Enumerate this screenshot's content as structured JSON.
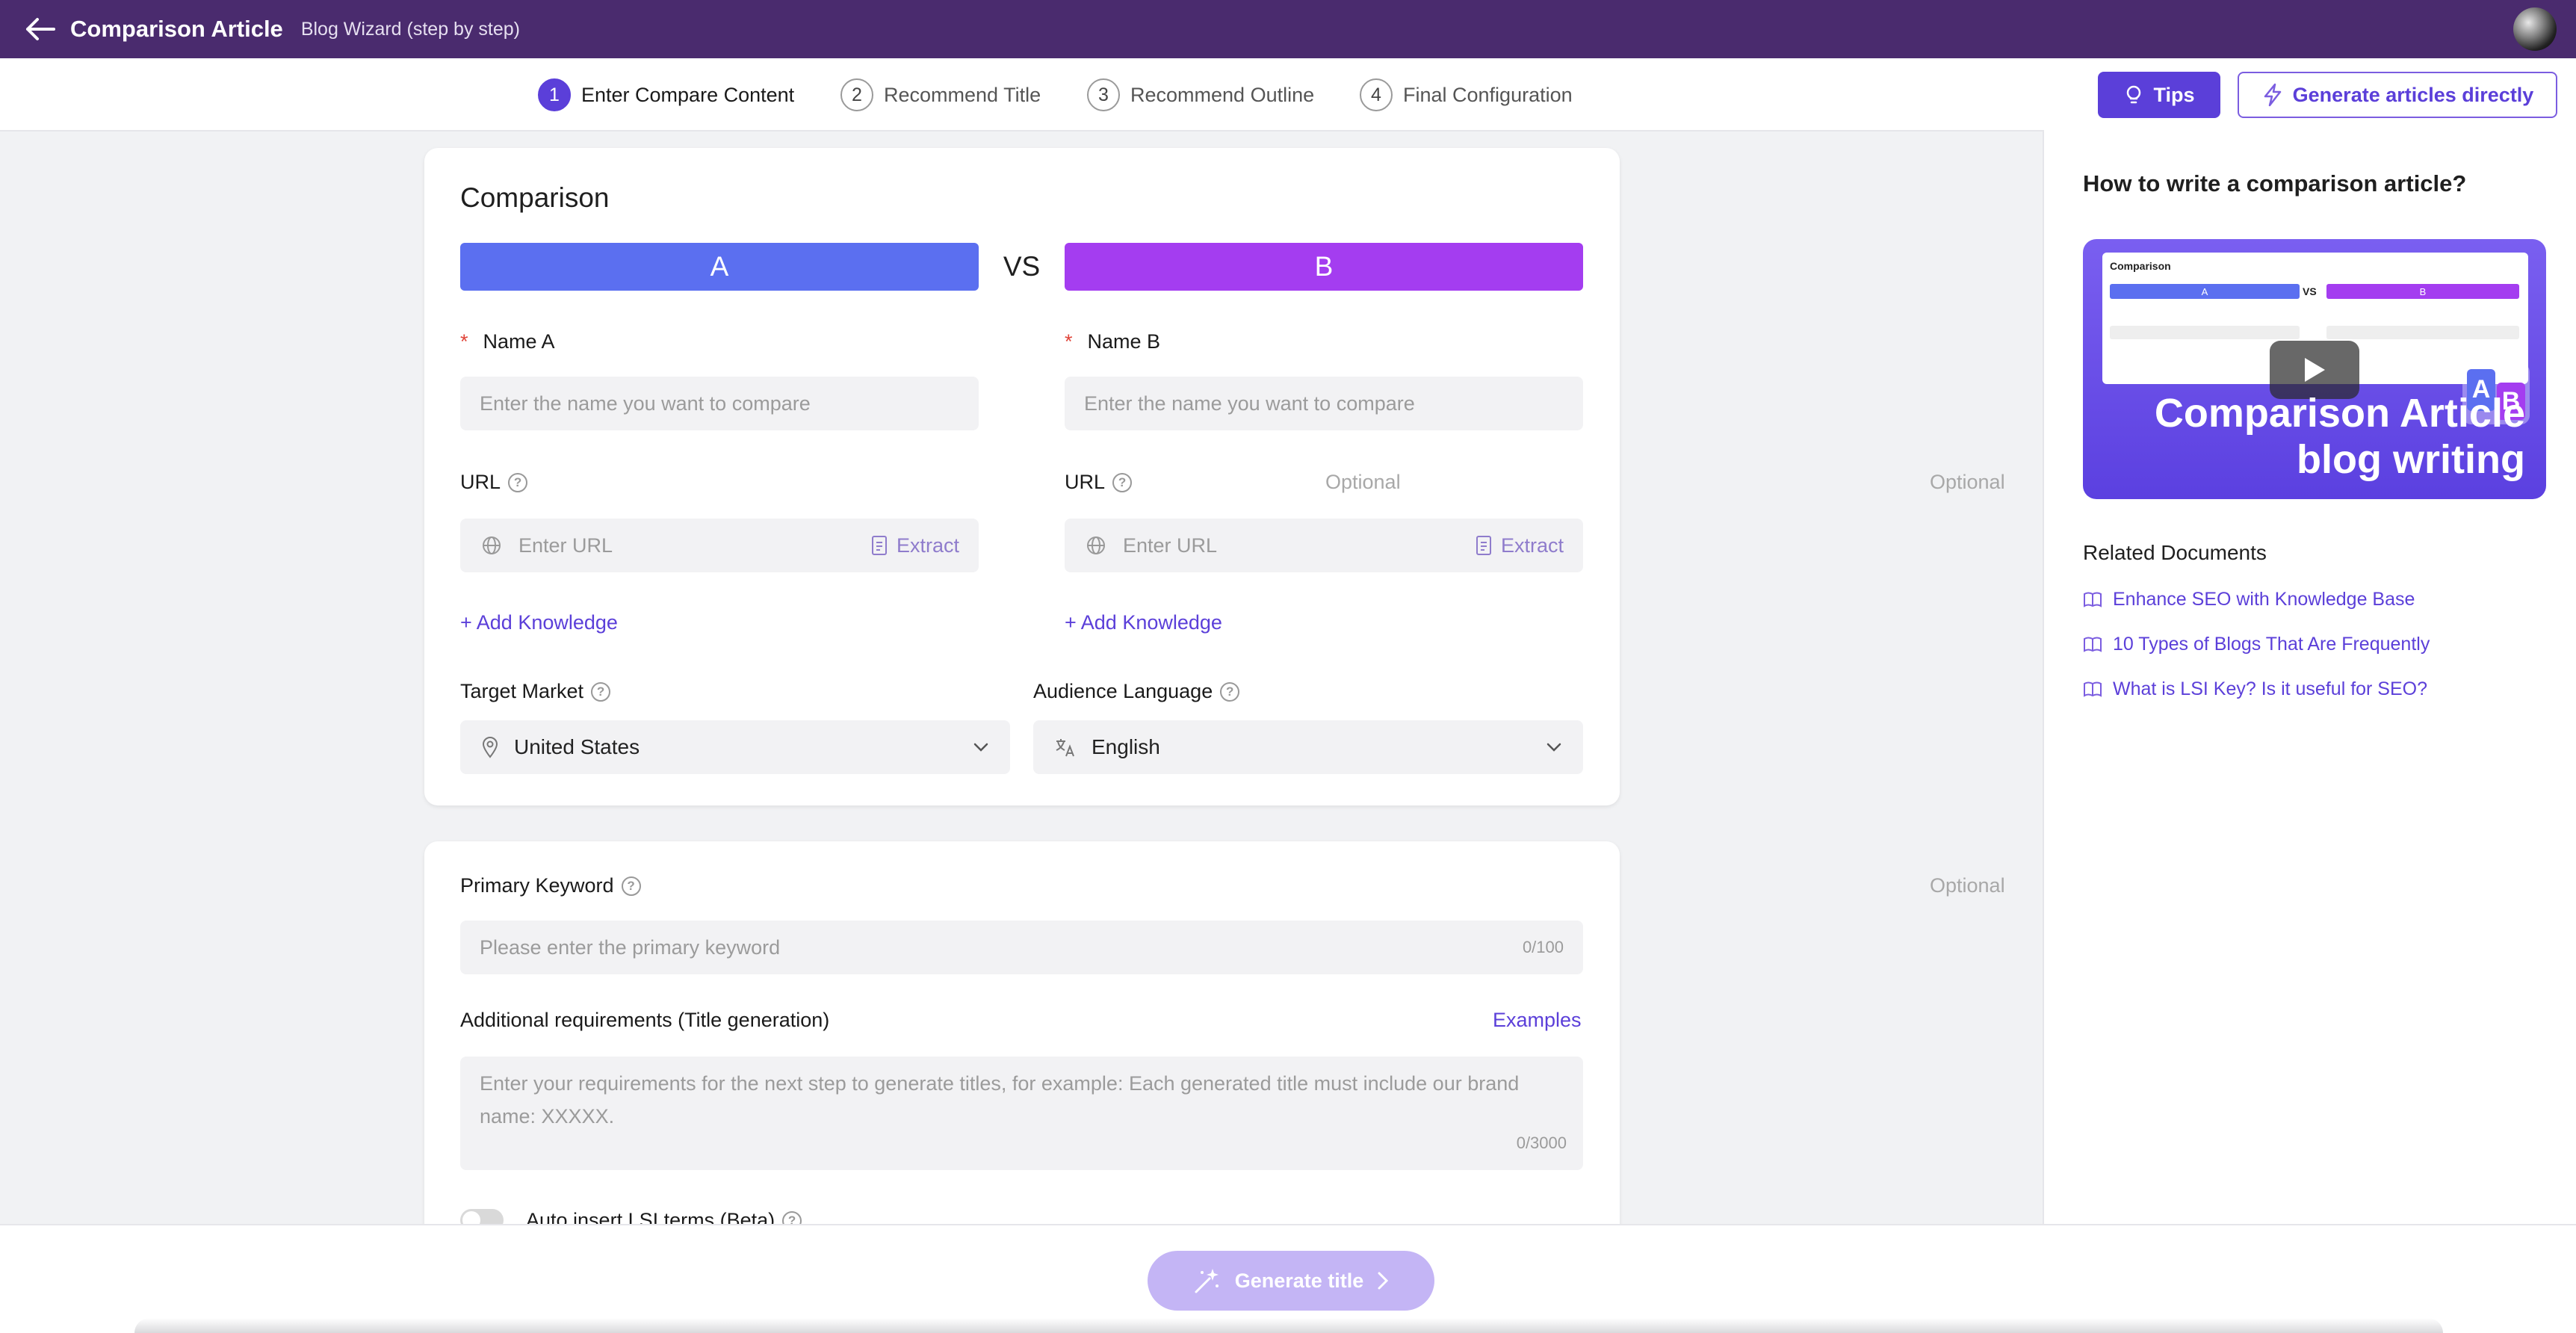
{
  "header": {
    "title": "Comparison Article",
    "subtitle": "Blog Wizard (step by step)"
  },
  "steps": [
    {
      "num": "1",
      "label": "Enter Compare Content",
      "active": true
    },
    {
      "num": "2",
      "label": "Recommend Title",
      "active": false
    },
    {
      "num": "3",
      "label": "Recommend Outline",
      "active": false
    },
    {
      "num": "4",
      "label": "Final Configuration",
      "active": false
    }
  ],
  "actions": {
    "tips": "Tips",
    "generate_direct": "Generate articles directly"
  },
  "comparison": {
    "heading": "Comparison",
    "a_label": "A",
    "b_label": "B",
    "vs": "VS",
    "name_a_label": "Name A",
    "name_b_label": "Name B",
    "name_placeholder": "Enter the name you want to compare",
    "url_label": "URL",
    "optional": "Optional",
    "url_placeholder": "Enter URL",
    "extract": "Extract",
    "add_knowledge": "+ Add Knowledge",
    "target_market_label": "Target Market",
    "target_market_value": "United States",
    "audience_language_label": "Audience Language",
    "audience_language_value": "English"
  },
  "keyword": {
    "primary_label": "Primary Keyword",
    "optional": "Optional",
    "primary_placeholder": "Please enter the primary keyword",
    "primary_counter": "0/100",
    "additional_label": "Additional requirements (Title generation)",
    "examples": "Examples",
    "additional_placeholder": "Enter your requirements for the next step to generate titles, for example: Each generated title must include our brand name: XXXXX.",
    "additional_counter": "0/3000",
    "lsi_label": "Auto insert LSI terms (Beta)"
  },
  "help": {
    "title": "How to write a comparison article?",
    "video": {
      "mini_title": "Comparison",
      "mini_a": "A",
      "mini_vs": "VS",
      "mini_b": "B",
      "headline_1": "Comparison Article",
      "headline_2": "blog writing"
    },
    "related_title": "Related Documents",
    "docs": [
      "Enhance SEO with Knowledge Base",
      "10 Types of Blogs That Are Frequently",
      "What is LSI Key? Is it useful for SEO?"
    ]
  },
  "footer": {
    "generate_title": "Generate title"
  },
  "colors": {
    "header_bg": "#4a2b6e",
    "accent": "#5b3fd9",
    "a_color": "#5b6ff0",
    "b_color": "#a43df0"
  }
}
